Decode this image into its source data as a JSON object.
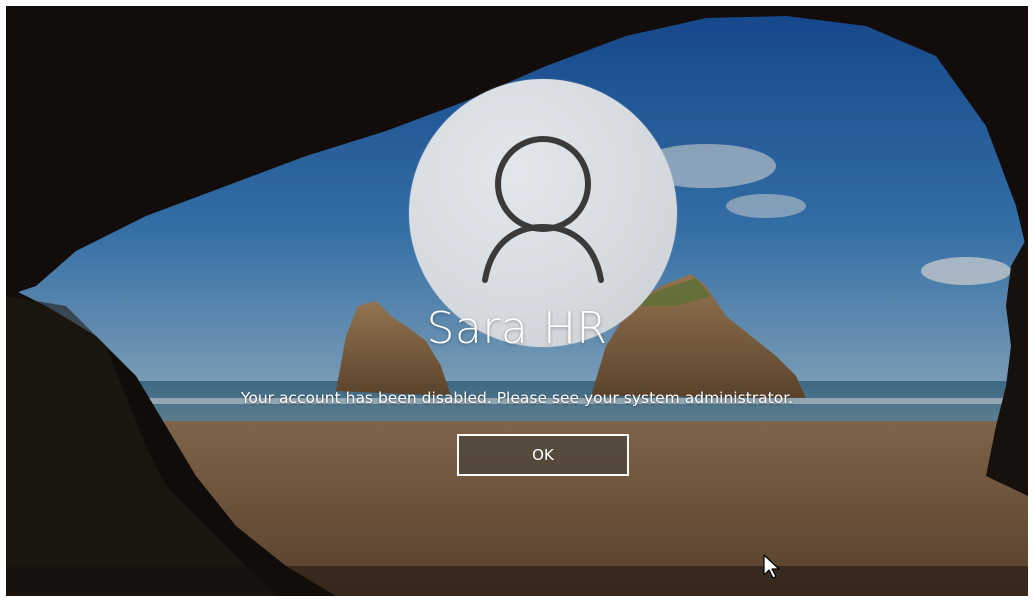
{
  "lock_screen": {
    "user_name": "Sara HR",
    "message": "Your account has been disabled. Please see your system administrator.",
    "ok_label": "OK"
  },
  "icons": {
    "avatar": "user-silhouette-icon",
    "cursor": "mouse-pointer-icon"
  },
  "colors": {
    "text": "#ffffff",
    "avatar_bg": "#d6dbe0",
    "avatar_glyph": "#3a3a3a"
  }
}
